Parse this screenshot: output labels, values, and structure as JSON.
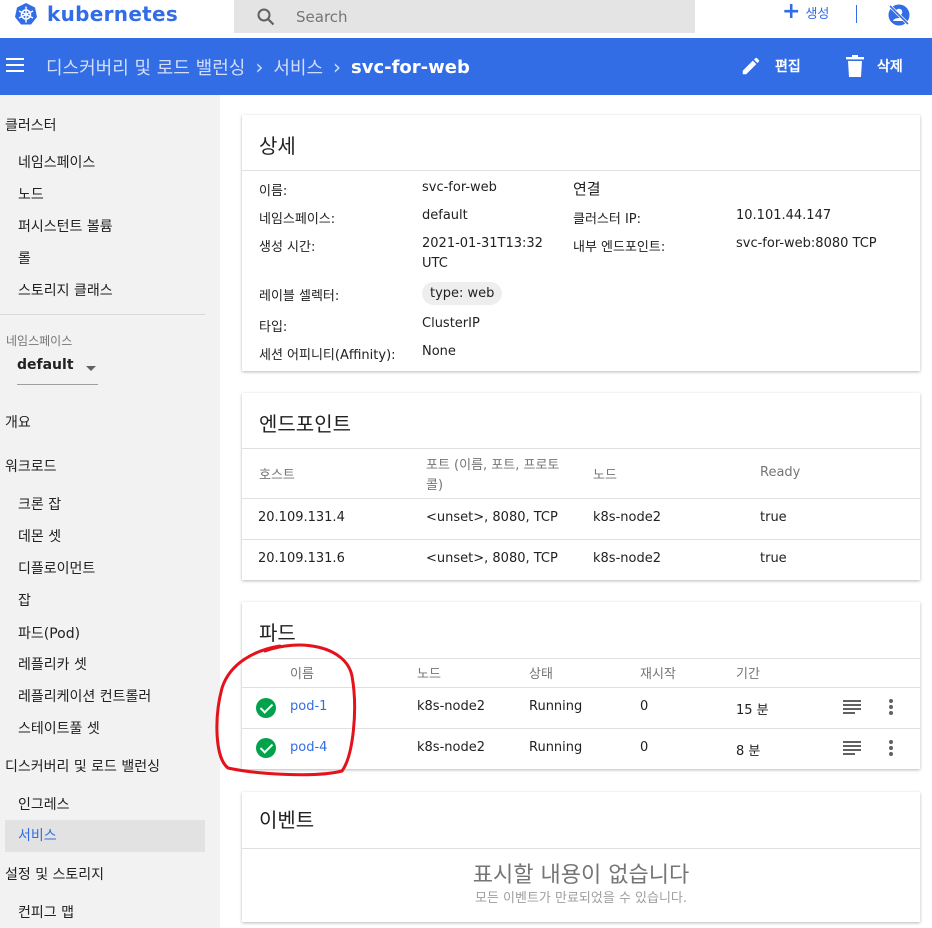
{
  "app": {
    "logo_text": "kubernetes"
  },
  "search": {
    "placeholder": "Search"
  },
  "topbar": {
    "create_label": "생성"
  },
  "header": {
    "breadcrumbs": [
      "디스커버리 및 로드 밸런싱",
      "서비스"
    ],
    "current": "svc-for-web",
    "edit_label": "편집",
    "delete_label": "삭제"
  },
  "sidebar": {
    "cluster": "클러스터",
    "cluster_items": [
      "네임스페이스",
      "노드",
      "퍼시스턴트 볼륨",
      "롤",
      "스토리지 클래스"
    ],
    "namespace_label": "네임스페이스",
    "namespace_value": "default",
    "overview": "개요",
    "workloads": "워크로드",
    "workload_items": [
      "크론 잡",
      "데몬 셋",
      "디플로이먼트",
      "잡",
      "파드(Pod)",
      "레플리카 셋",
      "레플리케이션 컨트롤러",
      "스테이트풀 셋"
    ],
    "discovery": "디스커버리 및 로드 밸런싱",
    "discovery_items": [
      "인그레스",
      "서비스"
    ],
    "config": "설정 및 스토리지",
    "config_items": [
      "컨피그 맵"
    ]
  },
  "details": {
    "title": "상세",
    "name_label": "이름:",
    "name_value": "svc-for-web",
    "ns_label": "네임스페이스:",
    "ns_value": "default",
    "created_label": "생성 시간:",
    "created_value_1": "2021-01-31T13:32",
    "created_value_2": "UTC",
    "selector_label": "레이블 셀렉터:",
    "selector_value": "type: web",
    "type_label": "타입:",
    "type_value": "ClusterIP",
    "affinity_label": "세션 어피니티(Affinity):",
    "affinity_value": "None",
    "conn_title": "연결",
    "cluster_ip_label": "클러스터 IP:",
    "cluster_ip_value": "10.101.44.147",
    "internal_ep_label": "내부 엔드포인트:",
    "internal_ep_value": "svc-for-web:8080 TCP"
  },
  "endpoints": {
    "title": "엔드포인트",
    "headers": {
      "host": "호스트",
      "ports_1": "포트 (이름, 포트, 프로토",
      "ports_2": "콜)",
      "node": "노드",
      "ready": "Ready"
    },
    "rows": [
      {
        "host": "20.109.131.4",
        "ports": "<unset>, 8080, TCP",
        "node": "k8s-node2",
        "ready": "true"
      },
      {
        "host": "20.109.131.6",
        "ports": "<unset>, 8080, TCP",
        "node": "k8s-node2",
        "ready": "true"
      }
    ]
  },
  "pods": {
    "title": "파드",
    "headers": {
      "name": "이름",
      "node": "노드",
      "status": "상태",
      "restarts": "재시작",
      "age": "기간"
    },
    "rows": [
      {
        "name": "pod-1",
        "node": "k8s-node2",
        "status": "Running",
        "restarts": "0",
        "age": "15 분"
      },
      {
        "name": "pod-4",
        "node": "k8s-node2",
        "status": "Running",
        "restarts": "0",
        "age": "8 분"
      }
    ]
  },
  "events": {
    "title": "이벤트",
    "empty_title": "표시할 내용이 없습니다",
    "empty_sub": "모든 이벤트가 만료되었을 수 있습니다."
  },
  "colors": {
    "accent": "#326de6",
    "status_ok": "#00a34b",
    "annotation": "#e3121b"
  }
}
